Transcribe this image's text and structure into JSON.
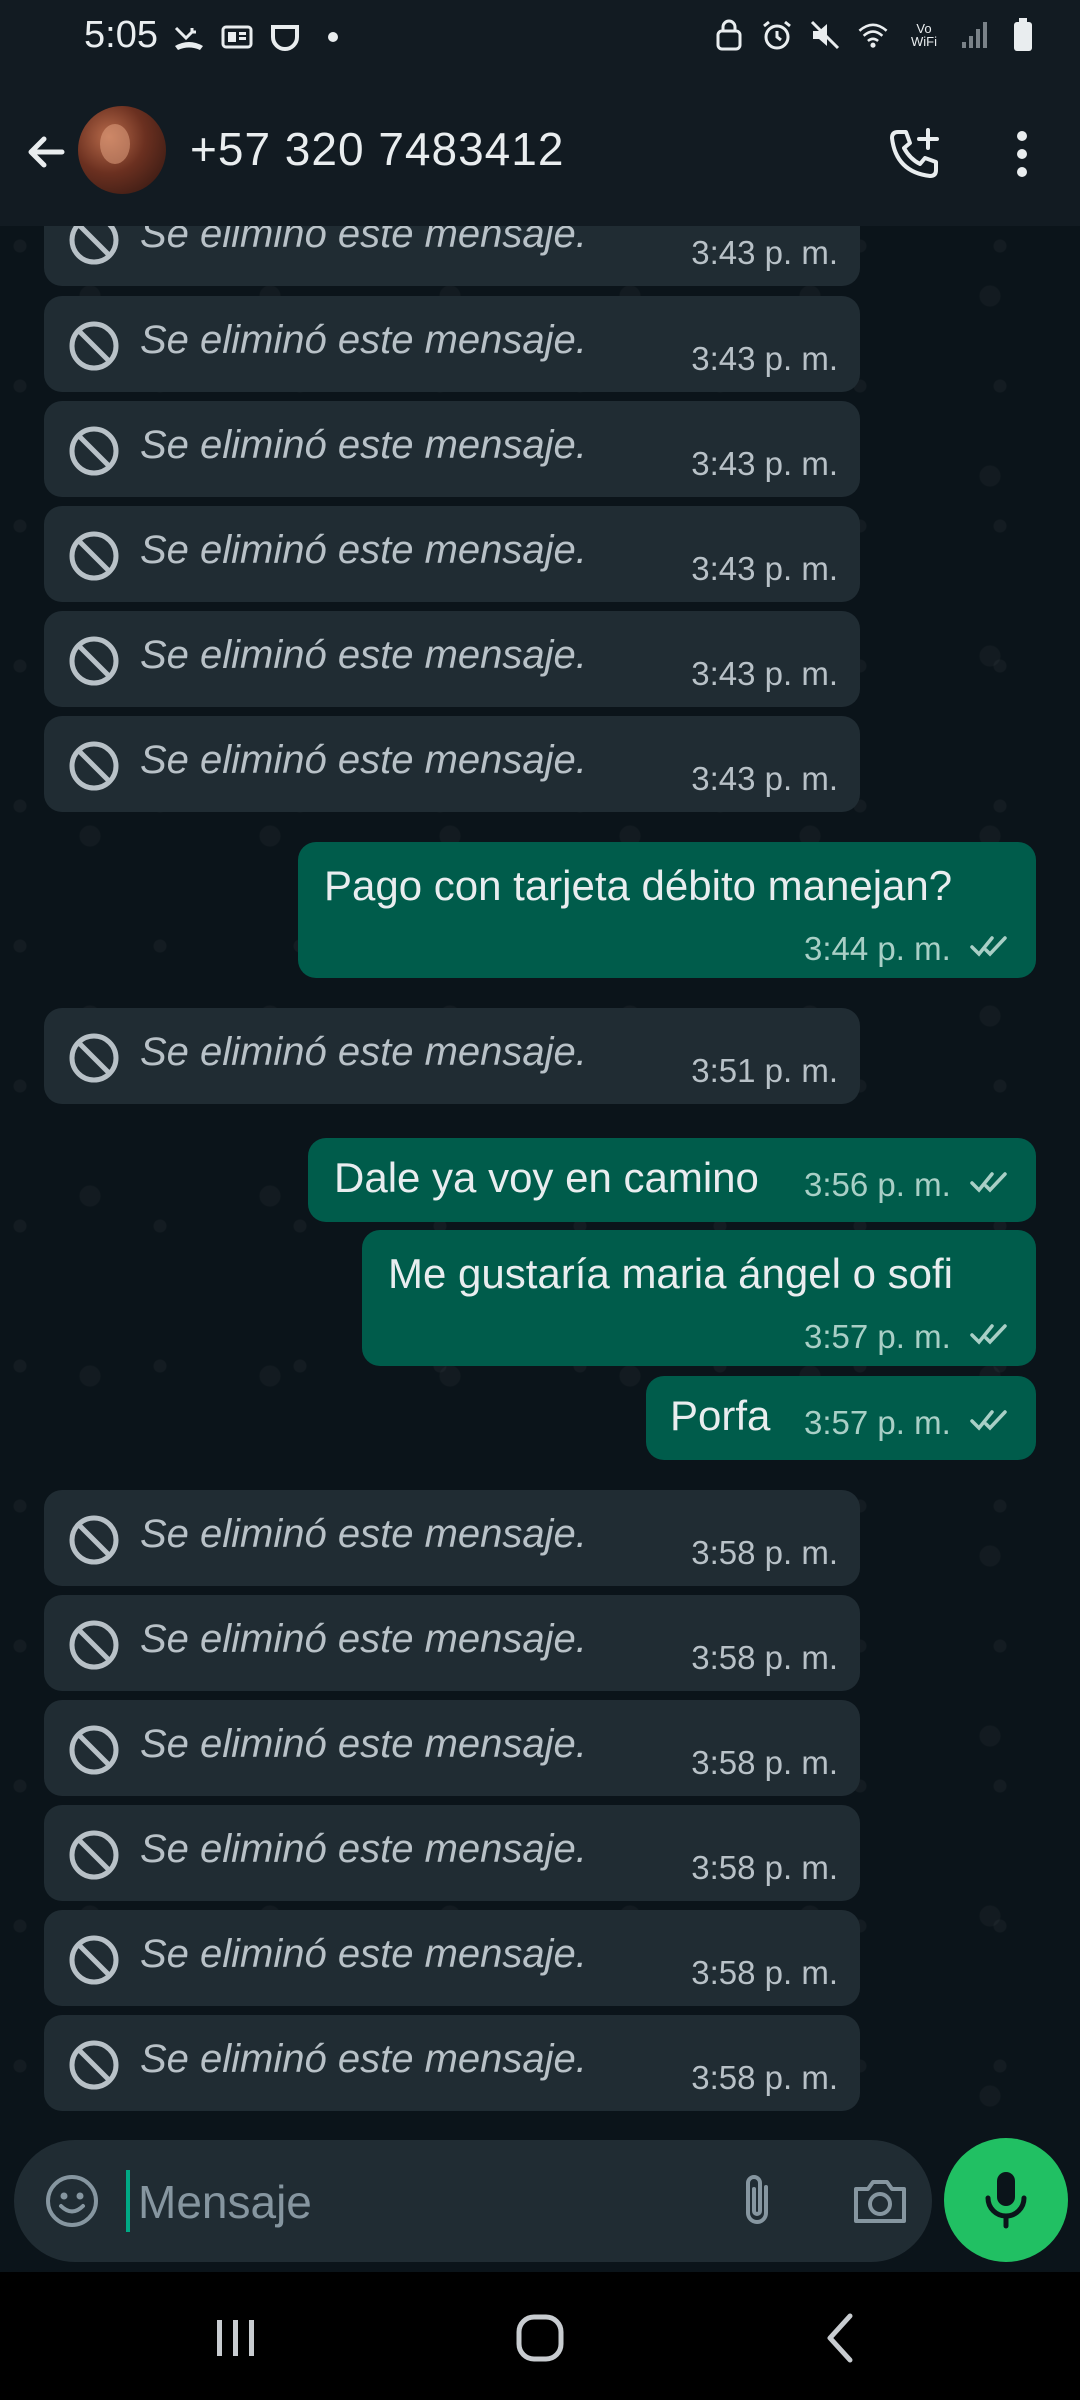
{
  "status_bar": {
    "time": "5:05",
    "left_icons": [
      "missed-call-icon",
      "gif-icon",
      "headset-icon",
      "notification-dot-icon"
    ],
    "right_icons": [
      "lock-icon",
      "alarm-icon",
      "mute-icon",
      "wifi-icon",
      "vowifi-icon",
      "signal-icon",
      "battery-icon"
    ],
    "vowifi_label": "Vo WiFi"
  },
  "header": {
    "contact": "+57 320 7483412"
  },
  "messages": [
    {
      "type": "deleted",
      "text": "Se eliminó este mensaje.",
      "time": "3:43 p. m."
    },
    {
      "type": "deleted",
      "text": "Se eliminó este mensaje.",
      "time": "3:43 p. m."
    },
    {
      "type": "deleted",
      "text": "Se eliminó este mensaje.",
      "time": "3:43 p. m."
    },
    {
      "type": "deleted",
      "text": "Se eliminó este mensaje.",
      "time": "3:43 p. m."
    },
    {
      "type": "deleted",
      "text": "Se eliminó este mensaje.",
      "time": "3:43 p. m."
    },
    {
      "type": "deleted",
      "text": "Se eliminó este mensaje.",
      "time": "3:43 p. m."
    },
    {
      "type": "outgoing",
      "text": "Pago con tarjeta débito manejan?",
      "time": "3:44 p. m.",
      "status": "read"
    },
    {
      "type": "deleted",
      "text": "Se eliminó este mensaje.",
      "time": "3:51 p. m."
    },
    {
      "type": "outgoing",
      "text": "Dale ya voy en camino",
      "time": "3:56 p. m.",
      "status": "read"
    },
    {
      "type": "outgoing",
      "text": "Me gustaría maria ángel o sofi",
      "time": "3:57 p. m.",
      "status": "read"
    },
    {
      "type": "outgoing",
      "text": "Porfa",
      "time": "3:57 p. m.",
      "status": "read"
    },
    {
      "type": "deleted",
      "text": "Se eliminó este mensaje.",
      "time": "3:58 p. m."
    },
    {
      "type": "deleted",
      "text": "Se eliminó este mensaje.",
      "time": "3:58 p. m."
    },
    {
      "type": "deleted",
      "text": "Se eliminó este mensaje.",
      "time": "3:58 p. m."
    },
    {
      "type": "deleted",
      "text": "Se eliminó este mensaje.",
      "time": "3:58 p. m."
    },
    {
      "type": "deleted",
      "text": "Se eliminó este mensaje.",
      "time": "3:58 p. m."
    },
    {
      "type": "deleted",
      "text": "Se eliminó este mensaje.",
      "time": "3:58 p. m."
    }
  ],
  "composer": {
    "placeholder": "Mensaje"
  },
  "colors": {
    "background": "#0b141a",
    "header": "#121b22",
    "incoming_bubble": "#202c33",
    "outgoing_bubble": "#005c4b",
    "accent": "#21c063"
  }
}
